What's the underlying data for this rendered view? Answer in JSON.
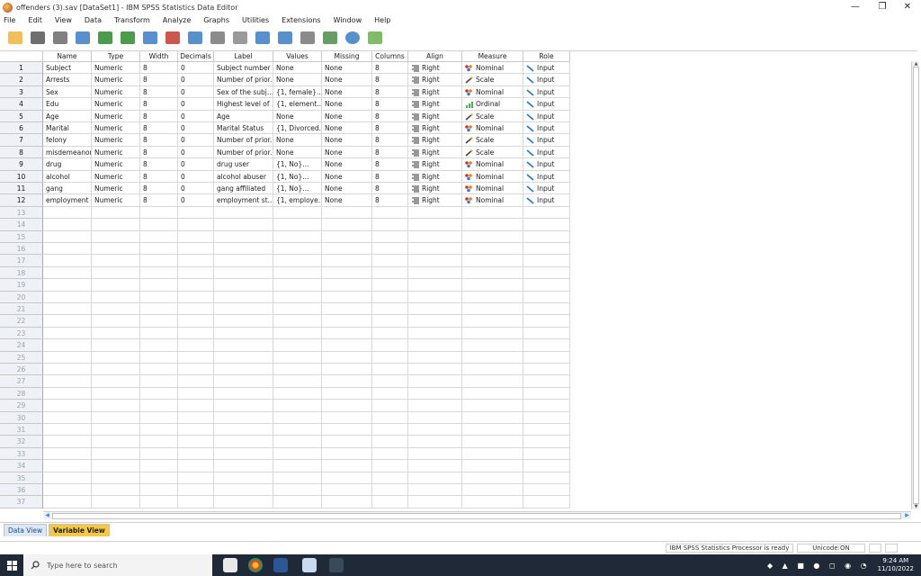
{
  "window": {
    "title": "offenders (3).sav [DataSet1] - IBM SPSS Statistics Data Editor",
    "minimize": "—",
    "maximize": "❐",
    "close": "✕"
  },
  "menu": [
    "File",
    "Edit",
    "View",
    "Data",
    "Transform",
    "Analyze",
    "Graphs",
    "Utilities",
    "Extensions",
    "Window",
    "Help"
  ],
  "toolbar_icons": [
    "open-folder-icon",
    "save-icon",
    "print-icon",
    "recall-dialog-icon",
    "undo-icon",
    "redo-icon",
    "goto-case-icon",
    "goto-variable-icon",
    "variables-icon",
    "run-descriptives-icon",
    "find-icon",
    "insert-cases-icon",
    "insert-variable-icon",
    "split-file-icon",
    "select-cases-icon",
    "value-labels-icon",
    "use-sets-icon"
  ],
  "columns": [
    "Name",
    "Type",
    "Width",
    "Decimals",
    "Label",
    "Values",
    "Missing",
    "Columns",
    "Align",
    "Measure",
    "Role"
  ],
  "variables": [
    {
      "row": "1",
      "name": "Subject",
      "type": "Numeric",
      "width": "8",
      "decimals": "0",
      "label": "Subject number",
      "values": "None",
      "missing": "None",
      "columns": "8",
      "align": "Right",
      "measure": "Nominal",
      "role": "Input"
    },
    {
      "row": "2",
      "name": "Arrests",
      "type": "Numeric",
      "width": "8",
      "decimals": "0",
      "label": "Number of prior...",
      "values": "None",
      "missing": "None",
      "columns": "8",
      "align": "Right",
      "measure": "Scale",
      "role": "Input"
    },
    {
      "row": "3",
      "name": "Sex",
      "type": "Numeric",
      "width": "8",
      "decimals": "0",
      "label": "Sex of the subj...",
      "values": "{1, female}...",
      "missing": "None",
      "columns": "8",
      "align": "Right",
      "measure": "Nominal",
      "role": "Input"
    },
    {
      "row": "4",
      "name": "Edu",
      "type": "Numeric",
      "width": "8",
      "decimals": "0",
      "label": "Highest level of ...",
      "values": "{1, element...",
      "missing": "None",
      "columns": "8",
      "align": "Right",
      "measure": "Ordinal",
      "role": "Input"
    },
    {
      "row": "5",
      "name": "Age",
      "type": "Numeric",
      "width": "8",
      "decimals": "0",
      "label": "Age",
      "values": "None",
      "missing": "None",
      "columns": "8",
      "align": "Right",
      "measure": "Scale",
      "role": "Input"
    },
    {
      "row": "6",
      "name": "Marital",
      "type": "Numeric",
      "width": "8",
      "decimals": "0",
      "label": "Marital Status",
      "values": "{1, Divorced...",
      "missing": "None",
      "columns": "8",
      "align": "Right",
      "measure": "Nominal",
      "role": "Input"
    },
    {
      "row": "7",
      "name": "felony",
      "type": "Numeric",
      "width": "8",
      "decimals": "0",
      "label": "Number of prior...",
      "values": "None",
      "missing": "None",
      "columns": "8",
      "align": "Right",
      "measure": "Scale",
      "role": "Input"
    },
    {
      "row": "8",
      "name": "misdemeanor",
      "type": "Numeric",
      "width": "8",
      "decimals": "0",
      "label": "Number of prior...",
      "values": "None",
      "missing": "None",
      "columns": "8",
      "align": "Right",
      "measure": "Scale",
      "role": "Input"
    },
    {
      "row": "9",
      "name": "drug",
      "type": "Numeric",
      "width": "8",
      "decimals": "0",
      "label": "drug user",
      "values": "{1, No}...",
      "missing": "None",
      "columns": "8",
      "align": "Right",
      "measure": "Nominal",
      "role": "Input"
    },
    {
      "row": "10",
      "name": "alcohol",
      "type": "Numeric",
      "width": "8",
      "decimals": "0",
      "label": "alcohol abuser",
      "values": "{1, No}...",
      "missing": "None",
      "columns": "8",
      "align": "Right",
      "measure": "Nominal",
      "role": "Input"
    },
    {
      "row": "11",
      "name": "gang",
      "type": "Numeric",
      "width": "8",
      "decimals": "0",
      "label": "gang affiliated",
      "values": "{1, No}...",
      "missing": "None",
      "columns": "8",
      "align": "Right",
      "measure": "Nominal",
      "role": "Input"
    },
    {
      "row": "12",
      "name": "employment",
      "type": "Numeric",
      "width": "8",
      "decimals": "0",
      "label": "employment st...",
      "values": "{1, employe...",
      "missing": "None",
      "columns": "8",
      "align": "Right",
      "measure": "Nominal",
      "role": "Input"
    }
  ],
  "empty_rows": [
    "13",
    "14",
    "15",
    "16",
    "17",
    "18",
    "19",
    "20",
    "21",
    "22",
    "23",
    "24",
    "25",
    "26",
    "27",
    "28",
    "29",
    "30",
    "31",
    "32",
    "33",
    "34",
    "35",
    "36",
    "37"
  ],
  "tabs": {
    "data_view": "Data View",
    "variable_view": "Variable View"
  },
  "status": {
    "processor": "IBM SPSS Statistics Processor is ready",
    "encoding": "Unicode:ON"
  },
  "taskbar": {
    "search_placeholder": "Type here to search",
    "time": "9:24 AM",
    "date": "11/10/2022"
  },
  "colors": {
    "active_tab": "#f5c842",
    "row_header": "#eef1f6",
    "taskbar": "#1f2937",
    "nominal": "#c0392b",
    "scale": "#444444",
    "ordinal": "#4caf50",
    "input_arrow": "#1a73c8"
  }
}
